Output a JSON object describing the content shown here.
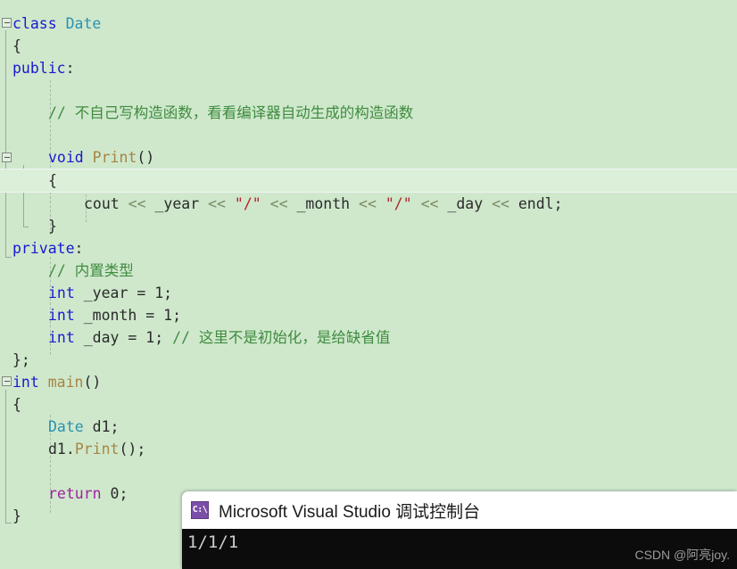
{
  "editor": {
    "background_color": "#cfe8cc",
    "current_line_color": "#dcefd9",
    "lines": [
      {
        "indent": 0,
        "tokens": [
          {
            "t": "class ",
            "c": "kw"
          },
          {
            "t": "Date",
            "c": "type"
          }
        ]
      },
      {
        "indent": 0,
        "tokens": [
          {
            "t": "{",
            "c": "br"
          }
        ]
      },
      {
        "indent": 0,
        "tokens": [
          {
            "t": "public",
            "c": "kw"
          },
          {
            "t": ":",
            "c": "pl"
          }
        ]
      },
      {
        "indent": 0,
        "tokens": []
      },
      {
        "indent": 1,
        "tokens": [
          {
            "t": "// 不自己写构造函数，看看编译器自动生成的构造函数",
            "c": "cm"
          }
        ]
      },
      {
        "indent": 0,
        "tokens": []
      },
      {
        "indent": 1,
        "tokens": [
          {
            "t": "void ",
            "c": "kw"
          },
          {
            "t": "Print",
            "c": "fn"
          },
          {
            "t": "()",
            "c": "pl"
          }
        ]
      },
      {
        "indent": 1,
        "current": true,
        "tokens": [
          {
            "t": "{",
            "c": "br"
          }
        ]
      },
      {
        "indent": 2,
        "tokens": [
          {
            "t": "cout ",
            "c": "pl"
          },
          {
            "t": "<< ",
            "c": "op"
          },
          {
            "t": "_year ",
            "c": "pl"
          },
          {
            "t": "<< ",
            "c": "op"
          },
          {
            "t": "\"/\"",
            "c": "str"
          },
          {
            "t": " << ",
            "c": "op"
          },
          {
            "t": "_month ",
            "c": "pl"
          },
          {
            "t": "<< ",
            "c": "op"
          },
          {
            "t": "\"/\"",
            "c": "str"
          },
          {
            "t": " << ",
            "c": "op"
          },
          {
            "t": "_day ",
            "c": "pl"
          },
          {
            "t": "<< ",
            "c": "op"
          },
          {
            "t": "endl;",
            "c": "pl"
          }
        ]
      },
      {
        "indent": 1,
        "tokens": [
          {
            "t": "}",
            "c": "br"
          }
        ]
      },
      {
        "indent": 0,
        "tokens": [
          {
            "t": "private",
            "c": "kw"
          },
          {
            "t": ":",
            "c": "pl"
          }
        ]
      },
      {
        "indent": 1,
        "tokens": [
          {
            "t": "// 内置类型",
            "c": "cm"
          }
        ]
      },
      {
        "indent": 1,
        "tokens": [
          {
            "t": "int",
            "c": "kw"
          },
          {
            "t": " _year = 1;",
            "c": "pl"
          }
        ]
      },
      {
        "indent": 1,
        "tokens": [
          {
            "t": "int",
            "c": "kw"
          },
          {
            "t": " _month = 1;",
            "c": "pl"
          }
        ]
      },
      {
        "indent": 1,
        "tokens": [
          {
            "t": "int",
            "c": "kw"
          },
          {
            "t": " _day = 1; ",
            "c": "pl"
          },
          {
            "t": "// 这里不是初始化，是给缺省值",
            "c": "cm"
          }
        ]
      },
      {
        "indent": 0,
        "tokens": [
          {
            "t": "};",
            "c": "br"
          }
        ]
      },
      {
        "indent": 0,
        "tokens": [
          {
            "t": "int ",
            "c": "kw"
          },
          {
            "t": "main",
            "c": "fn"
          },
          {
            "t": "()",
            "c": "pl"
          }
        ]
      },
      {
        "indent": 0,
        "tokens": [
          {
            "t": "{",
            "c": "br"
          }
        ]
      },
      {
        "indent": 1,
        "tokens": [
          {
            "t": "Date",
            "c": "type"
          },
          {
            "t": " d1;",
            "c": "pl"
          }
        ]
      },
      {
        "indent": 1,
        "tokens": [
          {
            "t": "d1.",
            "c": "pl"
          },
          {
            "t": "Print",
            "c": "fn"
          },
          {
            "t": "();",
            "c": "pl"
          }
        ]
      },
      {
        "indent": 0,
        "tokens": []
      },
      {
        "indent": 1,
        "tokens": [
          {
            "t": "return",
            "c": "ctl"
          },
          {
            "t": " 0;",
            "c": "pl"
          }
        ]
      },
      {
        "indent": 0,
        "tokens": [
          {
            "t": "}",
            "c": "br"
          }
        ]
      }
    ],
    "fold_boxes": [
      {
        "line": 0,
        "state": "expanded"
      },
      {
        "line": 6,
        "state": "expanded"
      },
      {
        "line": 16,
        "state": "expanded"
      }
    ]
  },
  "console": {
    "icon": "console-cmd-icon",
    "icon_glyph": "C:\\",
    "title": "Microsoft Visual Studio 调试控制台",
    "output": "1/1/1",
    "background_color": "#0c0c0c",
    "titlebar_color": "#ffffff"
  },
  "watermark": {
    "text": "CSDN @阿亮joy."
  }
}
